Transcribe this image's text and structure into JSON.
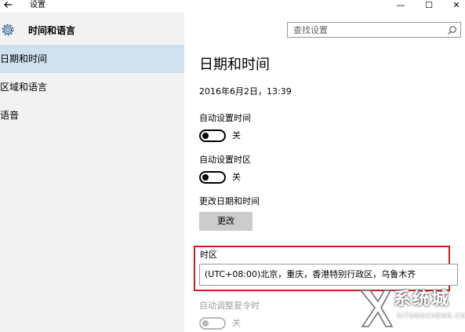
{
  "window": {
    "title": "设置",
    "back_icon": "back-arrow-icon",
    "minimize_glyph": "—",
    "maximize_glyph": "☐",
    "close_glyph": "✕"
  },
  "sidebar": {
    "title": "时间和语言",
    "icon": "gear-icon",
    "items": [
      {
        "label": "日期和时间",
        "active": true
      },
      {
        "label": "区域和语言",
        "active": false
      },
      {
        "label": "语音",
        "active": false
      }
    ]
  },
  "search": {
    "placeholder": "查找设置",
    "icon": "search-icon"
  },
  "main": {
    "title": "日期和时间",
    "current_datetime": "2016年6月2日，13:39",
    "auto_time": {
      "label": "自动设置时间",
      "state": "关"
    },
    "auto_timezone": {
      "label": "自动设置时区",
      "state": "关"
    },
    "change_datetime": {
      "label": "更改日期和时间",
      "button": "更改"
    },
    "timezone": {
      "label": "时区",
      "value": "(UTC+08:00)北京，重庆，香港特别行政区，乌鲁木齐"
    },
    "dst": {
      "label": "自动调整夏令时",
      "state": "关"
    }
  },
  "colors": {
    "sidebar_bg": "#f2f2f2",
    "selected_item_bg": "#cfe0ee",
    "highlight_border": "#c81e1e",
    "button_bg": "#cccccc"
  },
  "watermark": {
    "brand": "系统城",
    "url": "XITONGCHENG.COM"
  }
}
